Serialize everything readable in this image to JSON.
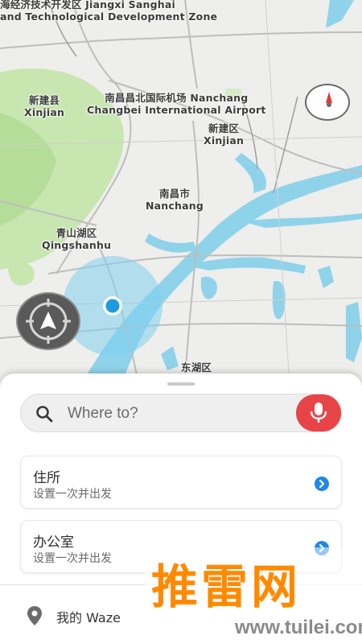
{
  "map": {
    "labels": {
      "zone_line1": "海经济技术开发区 Jiangxi Sanghai",
      "zone_line2": "and Technological Development Zone",
      "xinjian_county_cn": "新建县",
      "xinjian_county_en": "Xinjian",
      "airport_cn": "南昌昌北国际机场 Nanchang",
      "airport_en": "Changbei International Airport",
      "xinjian_district_cn": "新建区",
      "xinjian_district_en": "Xinjian",
      "nanchang_cn": "南昌市",
      "nanchang_en": "Nanchang",
      "qingshanhu_cn": "青山湖区",
      "qingshanhu_en": "Qingshanhu",
      "donghu_cn": "东湖区"
    },
    "compass_icon": "compass-icon",
    "recenter_icon": "recenter-icon",
    "colors": {
      "land": "#eeeeec",
      "park": "#c8e6b0",
      "water": "#8fd3ea",
      "road": "#b9b9b9",
      "location_halo": "#7fd0ee",
      "location_dot": "#1f9be0"
    }
  },
  "sheet": {
    "search": {
      "placeholder": "Where to?",
      "icon": "search-icon",
      "mic_icon": "microphone-icon"
    },
    "home": {
      "title": "住所",
      "subtitle": "设置一次并出发"
    },
    "work": {
      "title": "办公室",
      "subtitle": "设置一次并出发"
    },
    "my_places": "我的 Waze",
    "colors": {
      "mic_bg": "#e84447",
      "chevron": "#1e88e5"
    }
  },
  "watermark": {
    "brand": "推雷网",
    "url": "www.tuilei.com"
  }
}
